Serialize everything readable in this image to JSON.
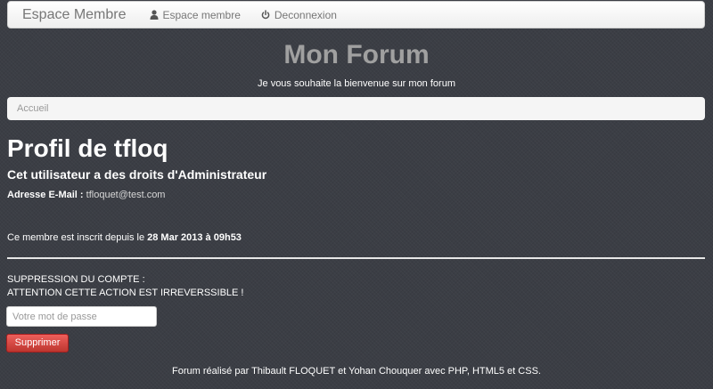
{
  "navbar": {
    "brand": "Espace Membre",
    "links": [
      {
        "label": "Espace membre",
        "icon": "user-icon"
      },
      {
        "label": "Deconnexion",
        "icon": "power-icon"
      }
    ]
  },
  "header": {
    "title": "Mon Forum",
    "subtitle": "Je vous souhaite la bienvenue sur mon forum"
  },
  "breadcrumb": {
    "label": "Accueil"
  },
  "profile": {
    "title": "Profil de tfloq",
    "role_text": "Cet utilisateur a des droits d'Administrateur",
    "email_label": "Adresse E-Mail :",
    "email_value": "tfloquet@test.com",
    "member_since_prefix": "Ce membre est inscrit depuis le",
    "member_since_date": "28 Mar 2013 à 09h53"
  },
  "account_deletion": {
    "title": "SUPPRESSION DU COMPTE :",
    "warning": "ATTENTION CETTE ACTION EST IRREVERSSIBLE !",
    "password_placeholder": "Votre mot de passe",
    "password_value": "",
    "button_label": "Supprimer"
  },
  "footer": {
    "text": "Forum réalisé par Thibault FLOQUET et Yohan Chouquer avec PHP, HTML5 et CSS."
  },
  "colors": {
    "background": "#3b3e45",
    "site_title": "#a0a0a0",
    "danger": "#bd362f"
  }
}
